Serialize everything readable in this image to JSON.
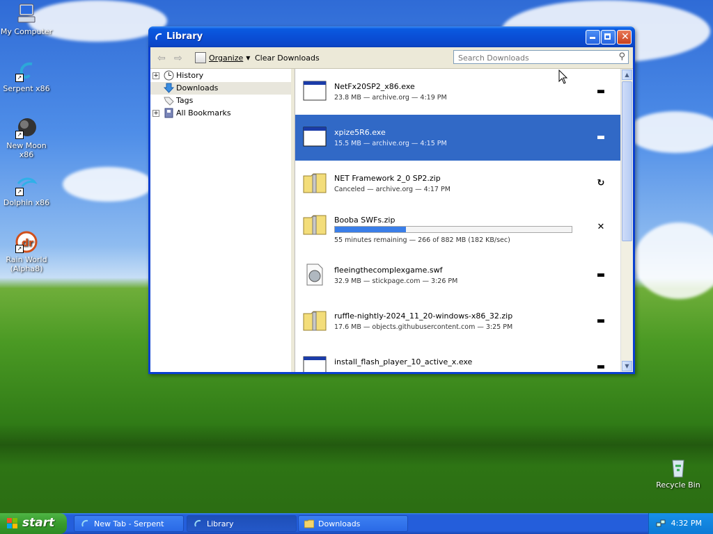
{
  "desktop": {
    "icons": [
      {
        "label": "My Computer"
      },
      {
        "label": "Serpent x86"
      },
      {
        "label": "New Moon x86"
      },
      {
        "label": "Dolphin x86"
      },
      {
        "label": "Rain World (Alpha8)"
      },
      {
        "label": "Recycle Bin"
      }
    ]
  },
  "window": {
    "title": "Library",
    "toolbar": {
      "organize_label": "Organize",
      "clear_label": "Clear Downloads",
      "search_placeholder": "Search Downloads"
    },
    "sidebar": {
      "items": [
        {
          "label": "History",
          "icon": "history-clock-icon"
        },
        {
          "label": "Downloads",
          "icon": "downloads-arrow-icon"
        },
        {
          "label": "Tags",
          "icon": "tag-icon"
        },
        {
          "label": "All Bookmarks",
          "icon": "bookmarks-icon"
        }
      ]
    },
    "downloads": [
      {
        "name": "NetFx20SP2_x86.exe",
        "meta": "23.8 MB — archive.org — 4:19 PM",
        "icon": "exe-file-icon",
        "action": "open-folder"
      },
      {
        "name": "xpize5R6.exe",
        "meta": "15.5 MB — archive.org — 4:15 PM",
        "icon": "exe-file-icon",
        "action": "open-folder"
      },
      {
        "name": "NET Framework 2_0 SP2.zip",
        "meta": "Canceled — archive.org — 4:17 PM",
        "icon": "zip-file-icon",
        "action": "retry"
      },
      {
        "name": "Booba SWFs.zip",
        "meta": "55 minutes remaining — 266 of 882 MB (182 KB/sec)",
        "icon": "zip-file-icon",
        "action": "cancel",
        "progress": 0.3
      },
      {
        "name": "fleeingthecomplexgame.swf",
        "meta": "32.9 MB — stickpage.com — 3:26 PM",
        "icon": "swf-file-icon",
        "action": "open-folder"
      },
      {
        "name": "ruffle-nightly-2024_11_20-windows-x86_32.zip",
        "meta": "17.6 MB — objects.githubusercontent.com — 3:25 PM",
        "icon": "zip-file-icon",
        "action": "open-folder"
      },
      {
        "name": "install_flash_player_10_active_x.exe",
        "meta": "",
        "icon": "exe-file-icon",
        "action": "open-folder"
      }
    ]
  },
  "taskbar": {
    "start_label": "start",
    "tasks": [
      {
        "label": "New Tab - Serpent"
      },
      {
        "label": "Library"
      },
      {
        "label": "Downloads"
      }
    ],
    "clock": "4:32 PM"
  },
  "colors": {
    "selection": "#3169c6",
    "title_blue": "#0a4fd6",
    "progress": "#3a7ee8"
  }
}
